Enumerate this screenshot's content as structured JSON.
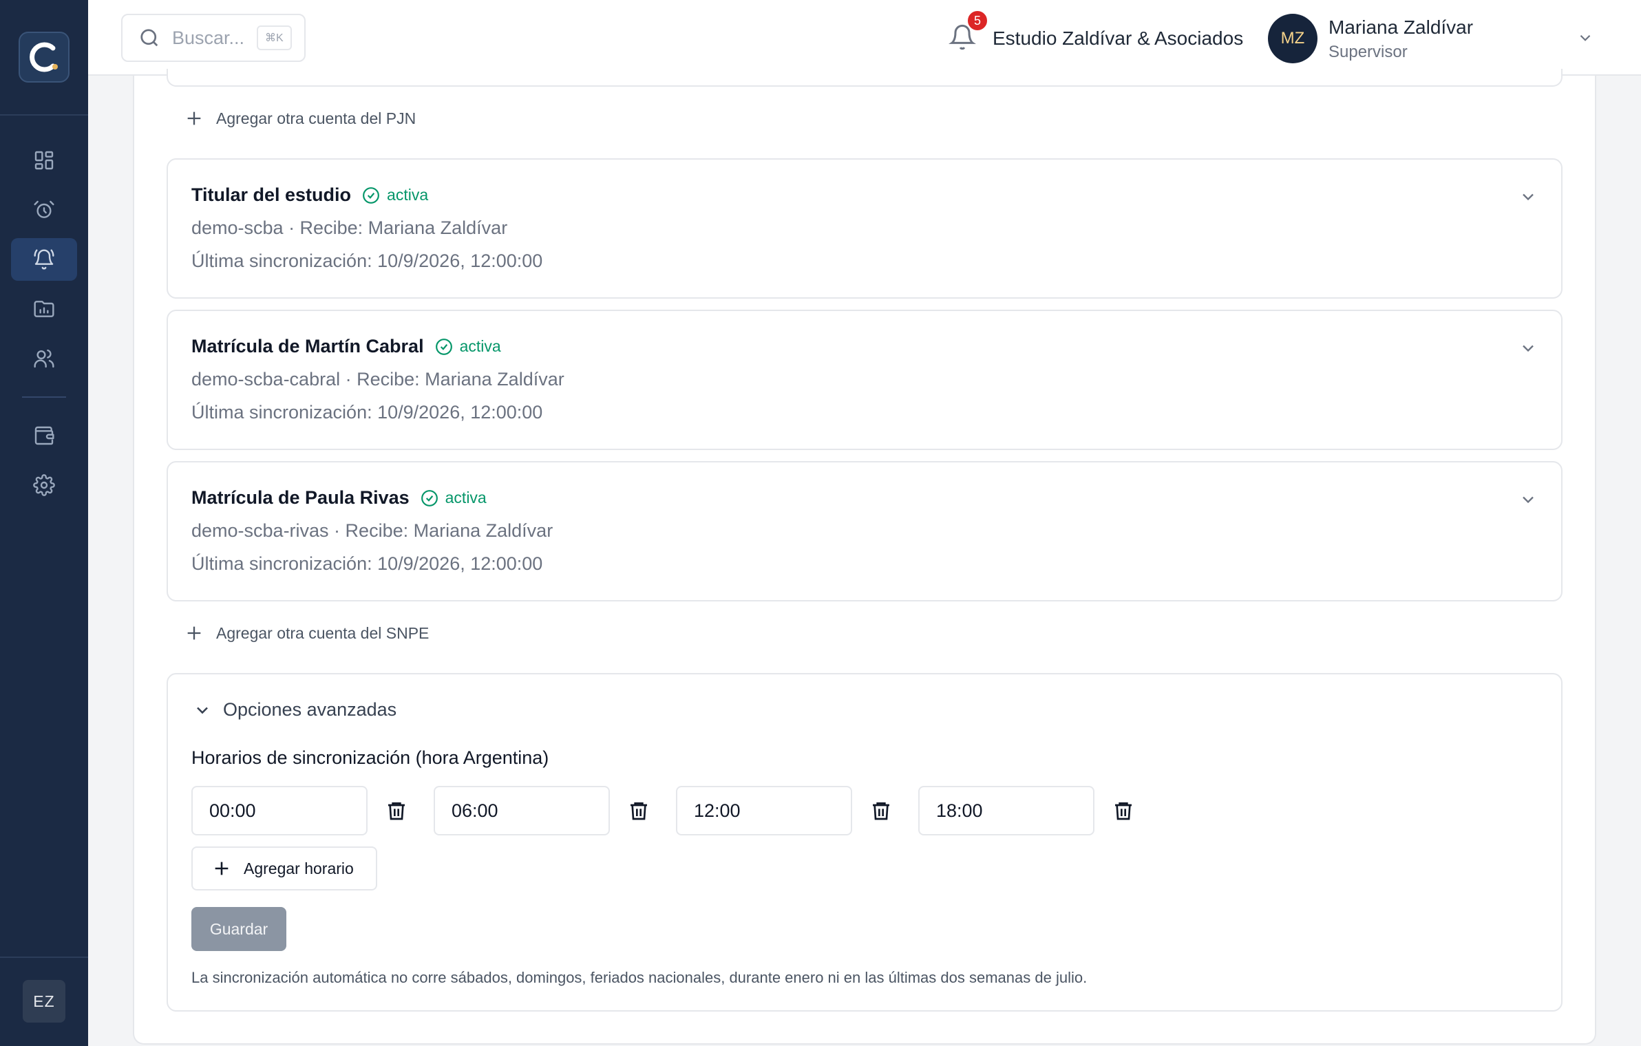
{
  "sidebar": {
    "logo_icon": "c-logo-icon",
    "nav": [
      {
        "icon": "dashboard-icon",
        "active": false
      },
      {
        "icon": "alarm-clock-icon",
        "active": false
      },
      {
        "icon": "bell-ring-icon",
        "active": true
      },
      {
        "icon": "folder-chart-icon",
        "active": false
      },
      {
        "icon": "users-icon",
        "active": false
      },
      {
        "icon": "wallet-icon",
        "active": false
      },
      {
        "icon": "settings-icon",
        "active": false
      }
    ],
    "user_initials": "EZ"
  },
  "header": {
    "search_placeholder": "Buscar...",
    "search_shortcut": "⌘K",
    "notifications_count": "5",
    "studio_name": "Estudio Zaldívar & Asociados",
    "user": {
      "initials": "MZ",
      "name": "Mariana Zaldívar",
      "role": "Supervisor"
    }
  },
  "main": {
    "add_pjn_label": "Agregar otra cuenta del PJN",
    "accounts": [
      {
        "title": "Titular del estudio",
        "status": "activa",
        "subtitle": "demo-scba · Recibe: Mariana Zaldívar",
        "last_sync": "Última sincronización: 10/9/2026, 12:00:00"
      },
      {
        "title": "Matrícula de Martín Cabral",
        "status": "activa",
        "subtitle": "demo-scba-cabral · Recibe: Mariana Zaldívar",
        "last_sync": "Última sincronización: 10/9/2026, 12:00:00"
      },
      {
        "title": "Matrícula de Paula Rivas",
        "status": "activa",
        "subtitle": "demo-scba-rivas · Recibe: Mariana Zaldívar",
        "last_sync": "Última sincronización: 10/9/2026, 12:00:00"
      }
    ],
    "add_snpe_label": "Agregar otra cuenta del SNPE",
    "advanced": {
      "toggle_label": "Opciones avanzadas",
      "schedule_label": "Horarios de sincronización (hora Argentina)",
      "times": [
        "00:00",
        "06:00",
        "12:00",
        "18:00"
      ],
      "add_time_label": "Agregar horario",
      "save_label": "Guardar",
      "note": "La sincronización automática no corre sábados, domingos, feriados nacionales, durante enero ni en las últimas dos semanas de julio."
    }
  },
  "colors": {
    "sidebar_bg": "#1b2a44",
    "active_nav_bg": "#26406a",
    "status_green": "#059669",
    "badge_red": "#dc2626",
    "disabled_button": "#8b95a3"
  }
}
